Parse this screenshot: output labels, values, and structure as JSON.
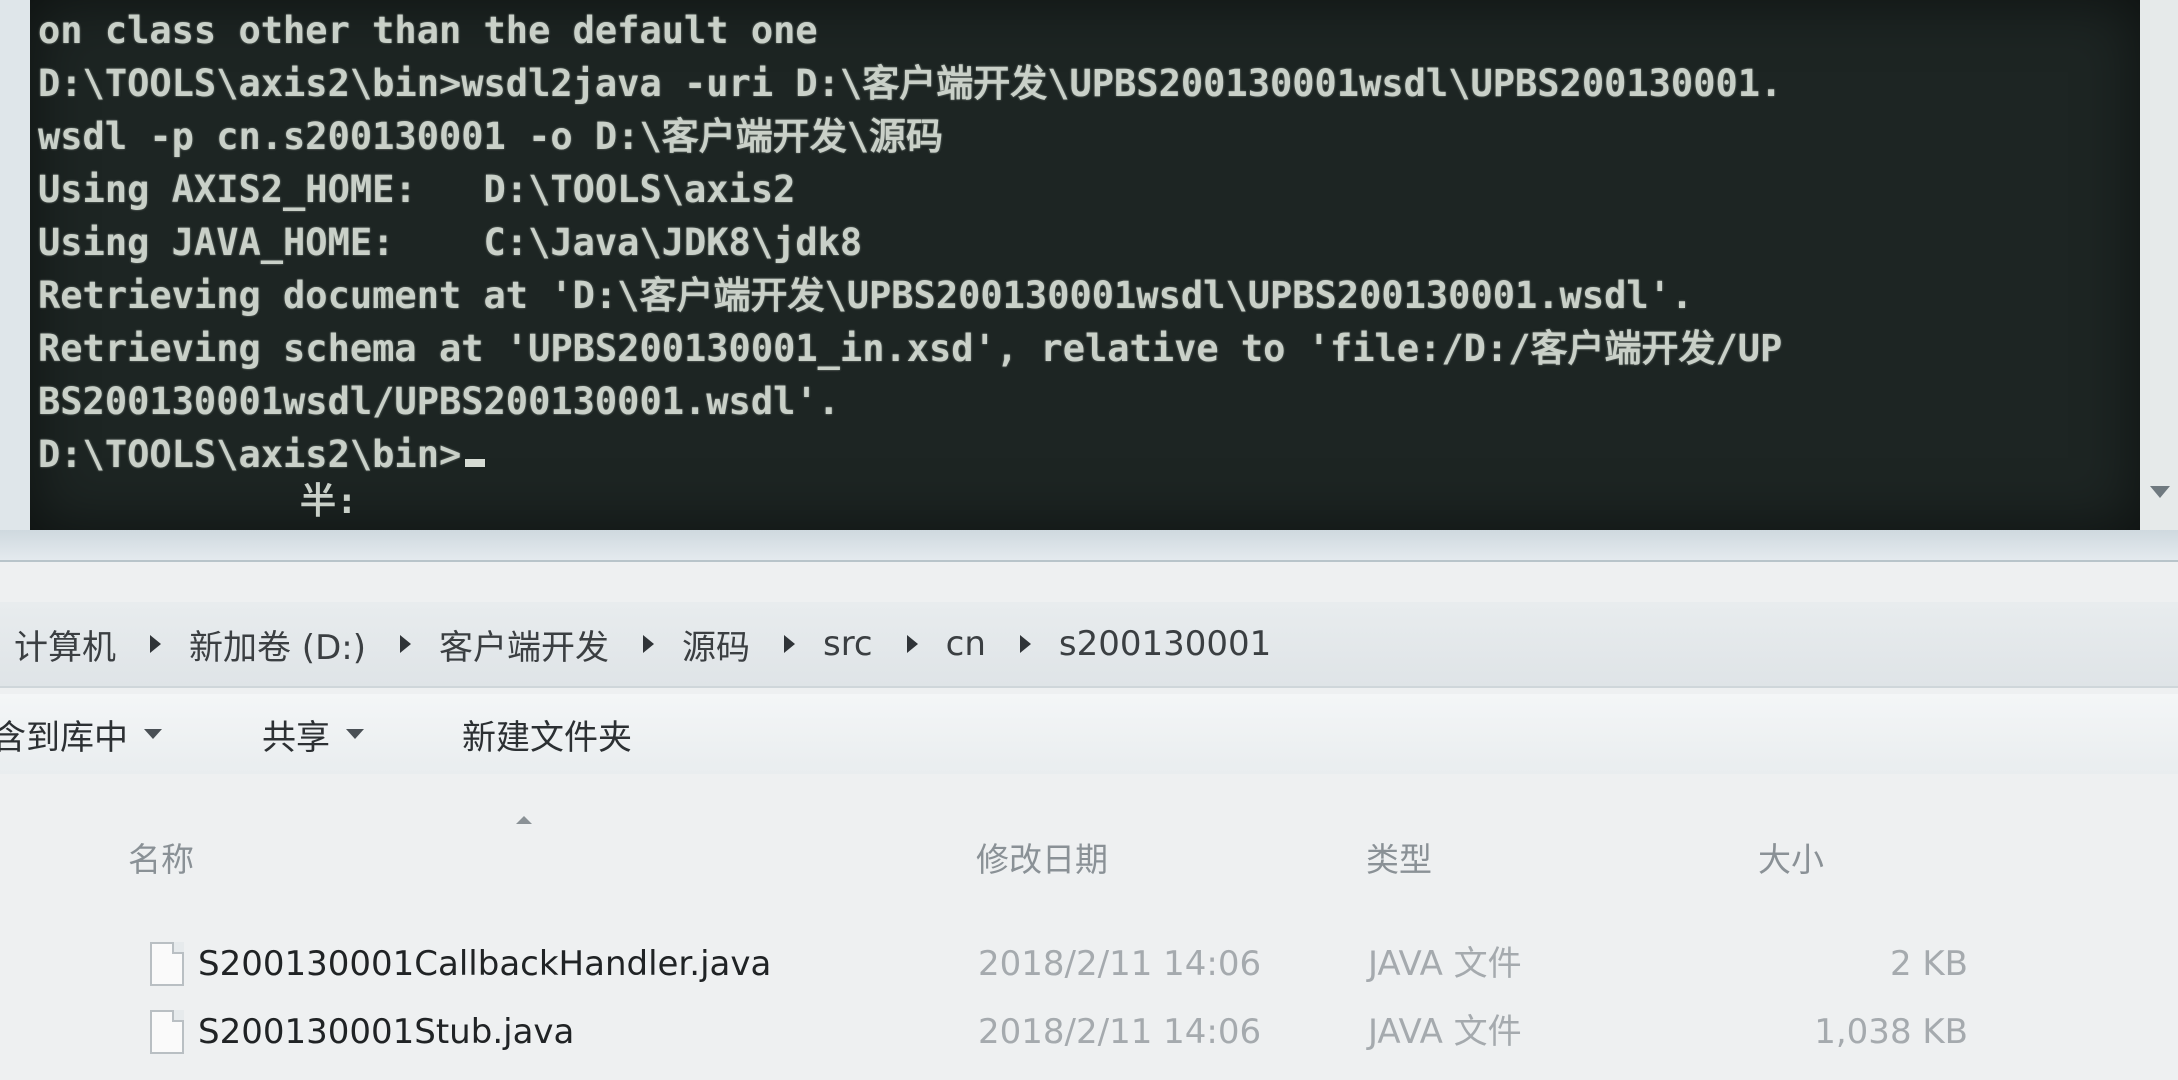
{
  "console": {
    "lines": [
      "on class other than the default one",
      "D:\\TOOLS\\axis2\\bin>wsdl2java -uri D:\\客户端开发\\UPBS200130001wsdl\\UPBS200130001.",
      "wsdl -p cn.s200130001 -o D:\\客户端开发\\源码",
      "Using AXIS2_HOME:   D:\\TOOLS\\axis2",
      "Using JAVA_HOME:    C:\\Java\\JDK8\\jdk8",
      "Retrieving document at 'D:\\客户端开发\\UPBS200130001wsdl\\UPBS200130001.wsdl'.",
      "Retrieving schema at 'UPBS200130001_in.xsd', relative to 'file:/D:/客户端开发/UP",
      "BS200130001wsdl/UPBS200130001.wsdl'.",
      "D:\\TOOLS\\axis2\\bin>"
    ],
    "ime_status": "半:"
  },
  "explorer": {
    "breadcrumb": [
      "计算机",
      "新加卷 (D:)",
      "客户端开发",
      "源码",
      "src",
      "cn",
      "s200130001"
    ],
    "toolbar": {
      "include_library": "含到库中",
      "share": "共享",
      "new_folder": "新建文件夹"
    },
    "columns": {
      "name": "名称",
      "modified": "修改日期",
      "type": "类型",
      "size": "大小"
    },
    "files": [
      {
        "name": "S200130001CallbackHandler.java",
        "modified": "2018/2/11 14:06",
        "type": "JAVA 文件",
        "size": "2 KB"
      },
      {
        "name": "S200130001Stub.java",
        "modified": "2018/2/11 14:06",
        "type": "JAVA 文件",
        "size": "1,038 KB"
      }
    ]
  }
}
